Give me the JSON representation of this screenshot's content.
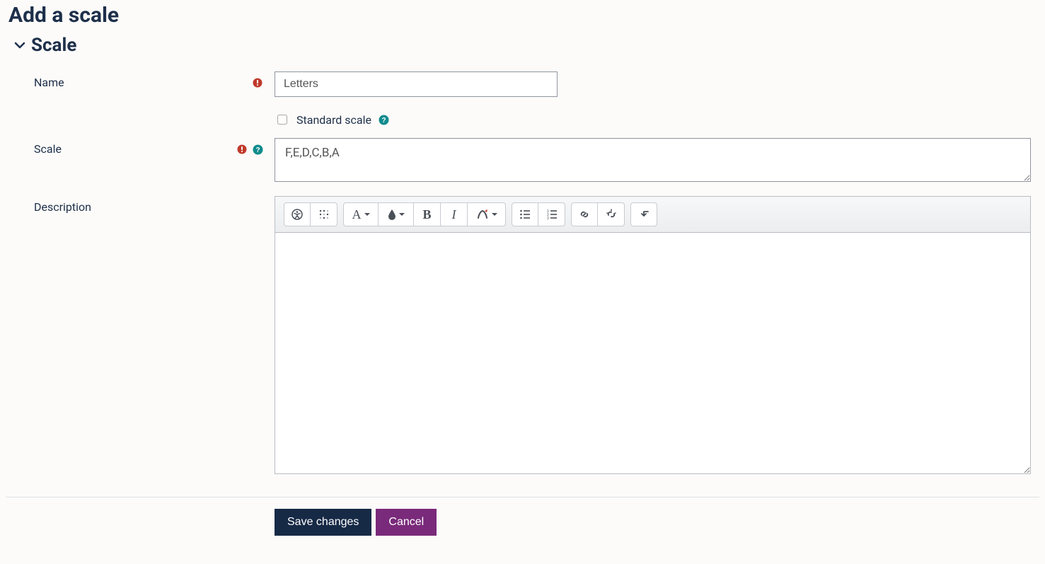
{
  "page": {
    "title": "Add a scale"
  },
  "section": {
    "title": "Scale"
  },
  "fields": {
    "name": {
      "label": "Name",
      "value": "Letters",
      "required": true
    },
    "standard": {
      "label": "Standard scale",
      "checked": false
    },
    "scale": {
      "label": "Scale",
      "value": "F,E,D,C,B,A",
      "required": true
    },
    "description": {
      "label": "Description",
      "value": ""
    }
  },
  "editor_toolbar": {
    "accessibility": "accessibility-helper",
    "screenreader": "screenreader-helper",
    "paragraph_styles": "paragraph-styles",
    "font_color": "font-color",
    "bold": "bold",
    "italic": "italic",
    "more_font": "more-font-options",
    "ul": "unordered-list",
    "ol": "ordered-list",
    "link": "link",
    "unlink": "unlink",
    "expand": "expand-toolbar"
  },
  "actions": {
    "save": "Save changes",
    "cancel": "Cancel"
  },
  "icons": {
    "required": "required",
    "help": "help"
  }
}
